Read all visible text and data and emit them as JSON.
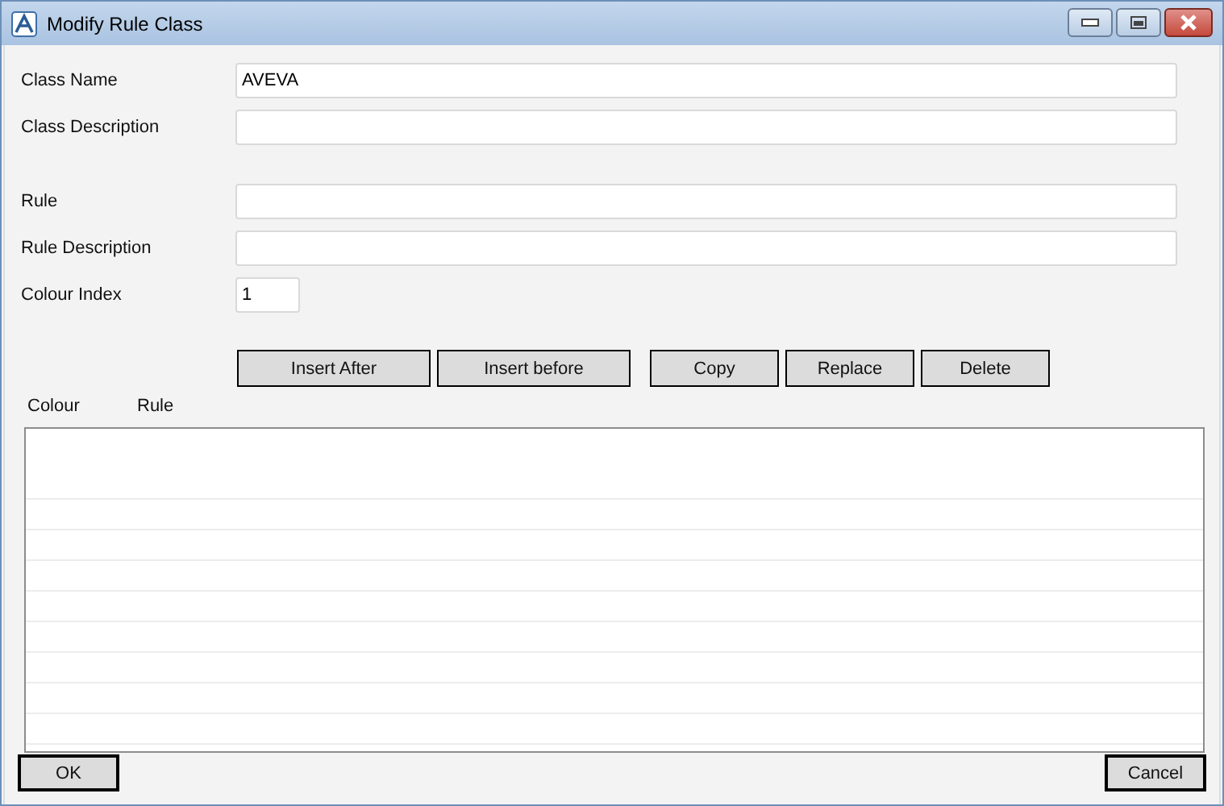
{
  "window": {
    "title": "Modify Rule Class"
  },
  "field_groups": [
    [
      {
        "label": "Class Name",
        "value": "AVEVA",
        "kind": "wide"
      },
      {
        "label": "Class Description",
        "kind": "wide"
      }
    ],
    [
      {
        "label": "Rule",
        "kind": "wide"
      },
      {
        "label": "Rule Description",
        "kind": "wide"
      },
      {
        "label": "Colour Index",
        "value": "1",
        "kind": "short"
      }
    ]
  ],
  "action_groups": [
    [
      {
        "label": "Insert After"
      },
      {
        "label": "Insert before"
      }
    ],
    [
      {
        "label": "Copy"
      },
      {
        "label": "Replace"
      },
      {
        "label": "Delete"
      }
    ]
  ],
  "list": {
    "columns": [
      "Colour",
      "Rule"
    ]
  },
  "buttons": [
    {
      "label": "OK"
    },
    {
      "label": "Cancel"
    }
  ]
}
